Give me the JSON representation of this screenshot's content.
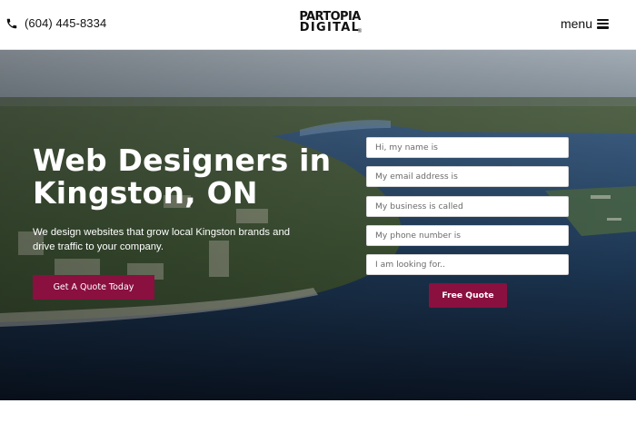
{
  "header": {
    "phone": "(604) 445-8334",
    "logo_line1": "PARTOPIA",
    "logo_line2": "DIGITAL",
    "logo_mark": "®",
    "menu_label": "menu",
    "phone_icon": "phone-icon",
    "menu_icon": "hamburger-icon"
  },
  "hero": {
    "headline": "Web Designers in Kingston, ON",
    "subtext": "We design websites that grow local Kingston brands and drive traffic to your company.",
    "cta_label": "Get A Quote Today",
    "background": "aerial photo of Kingston waterfront"
  },
  "form": {
    "name_placeholder": "Hi, my name is",
    "email_placeholder": "My email address is",
    "business_placeholder": "My business is called",
    "phone_placeholder": "My phone number is",
    "looking_for_placeholder": "I am looking for..",
    "submit_label": "Free Quote"
  },
  "colors": {
    "accent": "#8a1040",
    "text_dark": "#111111",
    "header_bg": "#ffffff"
  }
}
